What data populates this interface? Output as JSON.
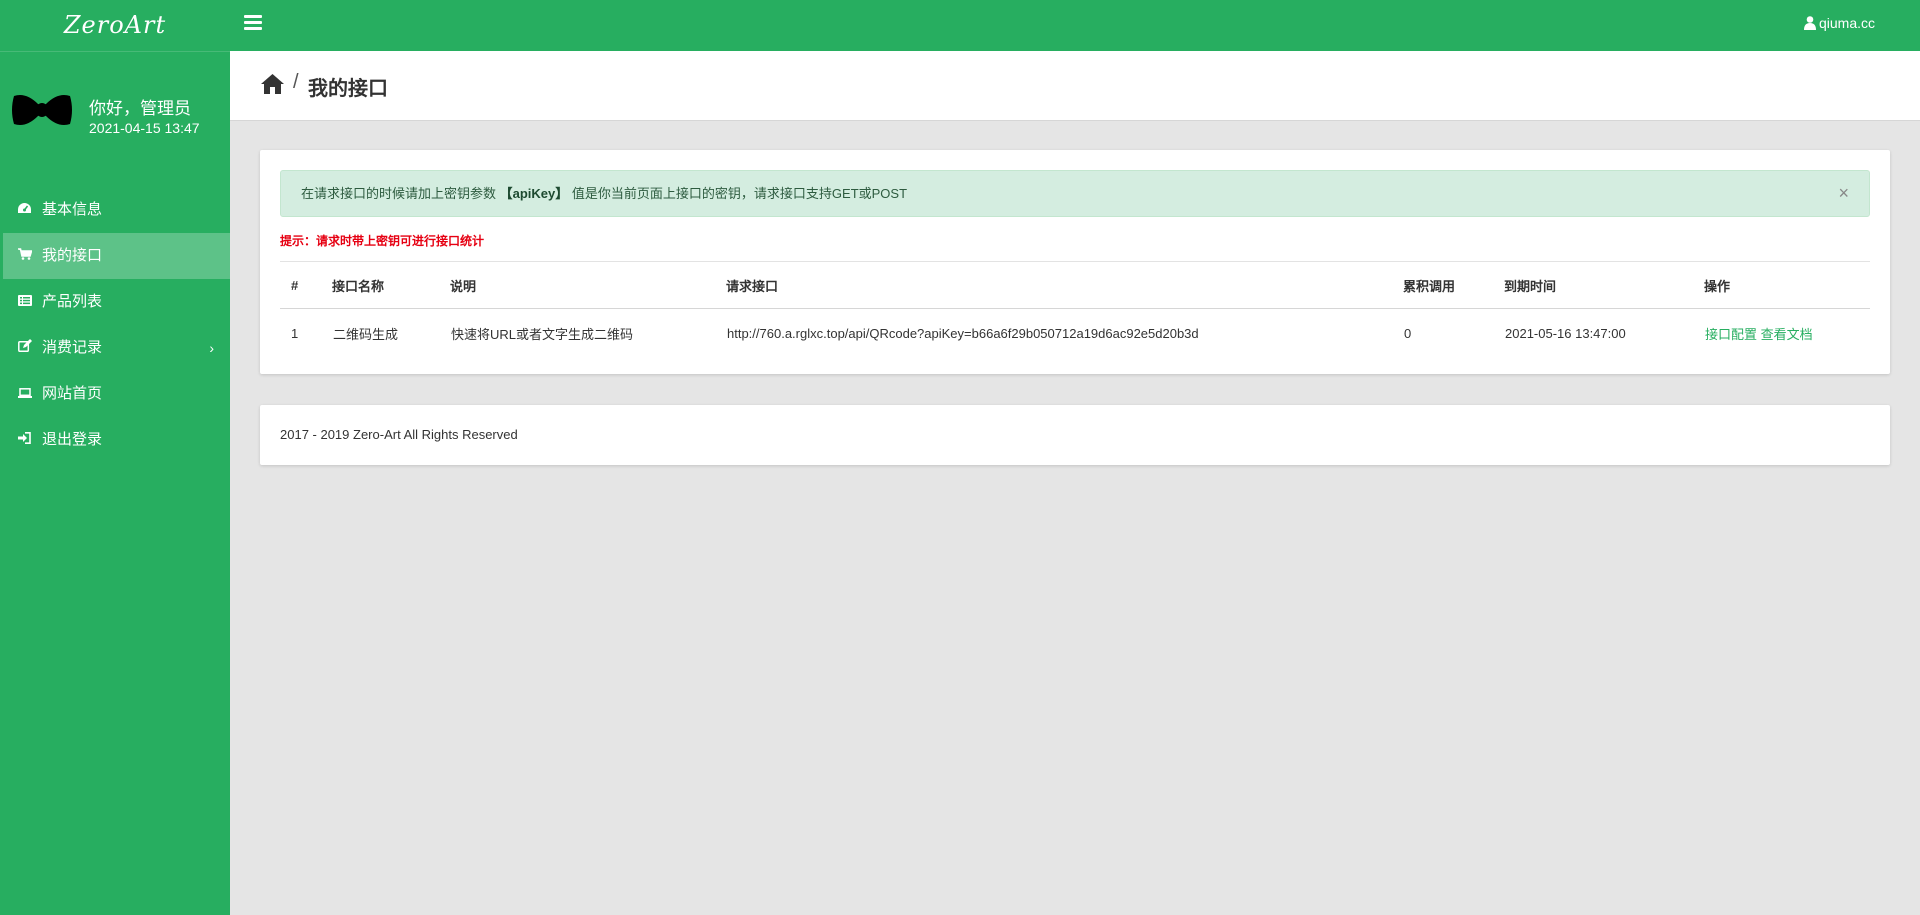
{
  "brand": "ZeroArt",
  "user": {
    "greeting": "你好，管理员",
    "datetime": "2021-04-15 13:47"
  },
  "sidebar": {
    "items": [
      {
        "label": "基本信息",
        "icon": "dashboard-icon"
      },
      {
        "label": "我的接口",
        "icon": "cart-icon",
        "active": true
      },
      {
        "label": "产品列表",
        "icon": "list-icon"
      },
      {
        "label": "消费记录",
        "icon": "edit-icon",
        "has_submenu": true
      },
      {
        "label": "网站首页",
        "icon": "laptop-icon"
      },
      {
        "label": "退出登录",
        "icon": "sign-in-icon"
      }
    ]
  },
  "topbar": {
    "username": "qiuma.cc"
  },
  "page": {
    "title": "我的接口"
  },
  "alert": {
    "text_before": "在请求接口的时候请加上密钥参数",
    "highlight": "【apiKey】",
    "text_after": "值是你当前页面上接口的密钥，请求接口支持GET或POST",
    "close": "×"
  },
  "hint": "提示：请求时带上密钥可进行接口统计",
  "table": {
    "headers": [
      "#",
      "接口名称",
      "说明",
      "请求接口",
      "累积调用",
      "到期时间",
      "操作"
    ],
    "rows": [
      {
        "index": "1",
        "name": "二维码生成",
        "desc": "快速将URL或者文字生成二维码",
        "url": "http://760.a.rglxc.top/api/QRcode?apiKey=b66a6f29b050712a19d6ac92e5d20b3d",
        "calls": "0",
        "expire": "2021-05-16 13:47:00",
        "action_config": "接口配置",
        "action_docs": "查看文档"
      }
    ]
  },
  "footer": "2017 - 2019 Zero-Art All Rights Reserved",
  "colors": {
    "primary": "#27ae60",
    "alert_bg": "#d4ede0",
    "danger": "#e60012"
  }
}
